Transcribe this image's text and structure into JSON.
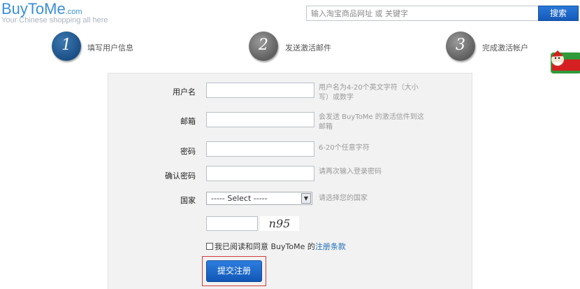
{
  "header": {
    "logo_main": "BuyToMe",
    "logo_domain": ".com",
    "logo_tagline": "Your Chinese shopping all here",
    "search_placeholder": "输入淘宝商品网址 或 关键字",
    "search_button": "搜索"
  },
  "steps": [
    {
      "number": "1",
      "label": "填写用户信息",
      "active": true
    },
    {
      "number": "2",
      "label": "发送激活邮件",
      "active": false
    },
    {
      "number": "3",
      "label": "完成激活帐户",
      "active": false
    }
  ],
  "form": {
    "username": {
      "label": "用户名",
      "hint": "用户名为4-20个英文字符（大小写）或数字"
    },
    "email": {
      "label": "邮箱",
      "hint": "会发送 BuyToMe 的激活信件到这邮箱"
    },
    "password": {
      "label": "密码",
      "hint": "6-20个任意字符"
    },
    "confirm_password": {
      "label": "确认密码",
      "hint": "请再次输入登录密码"
    },
    "country": {
      "label": "国家",
      "selected": "----- Select -----",
      "hint": "请选择您的国家"
    },
    "captcha_text": "n95",
    "agree_text": "我已阅读和同意 BuyToMe 的",
    "agree_link": "注册条款",
    "submit": "提交注册"
  },
  "colors": {
    "brand_blue": "#3a8fd8",
    "button_blue": "#1a66c8",
    "highlight_red": "#d43b3b",
    "panel_bg": "#f2f2f2"
  }
}
